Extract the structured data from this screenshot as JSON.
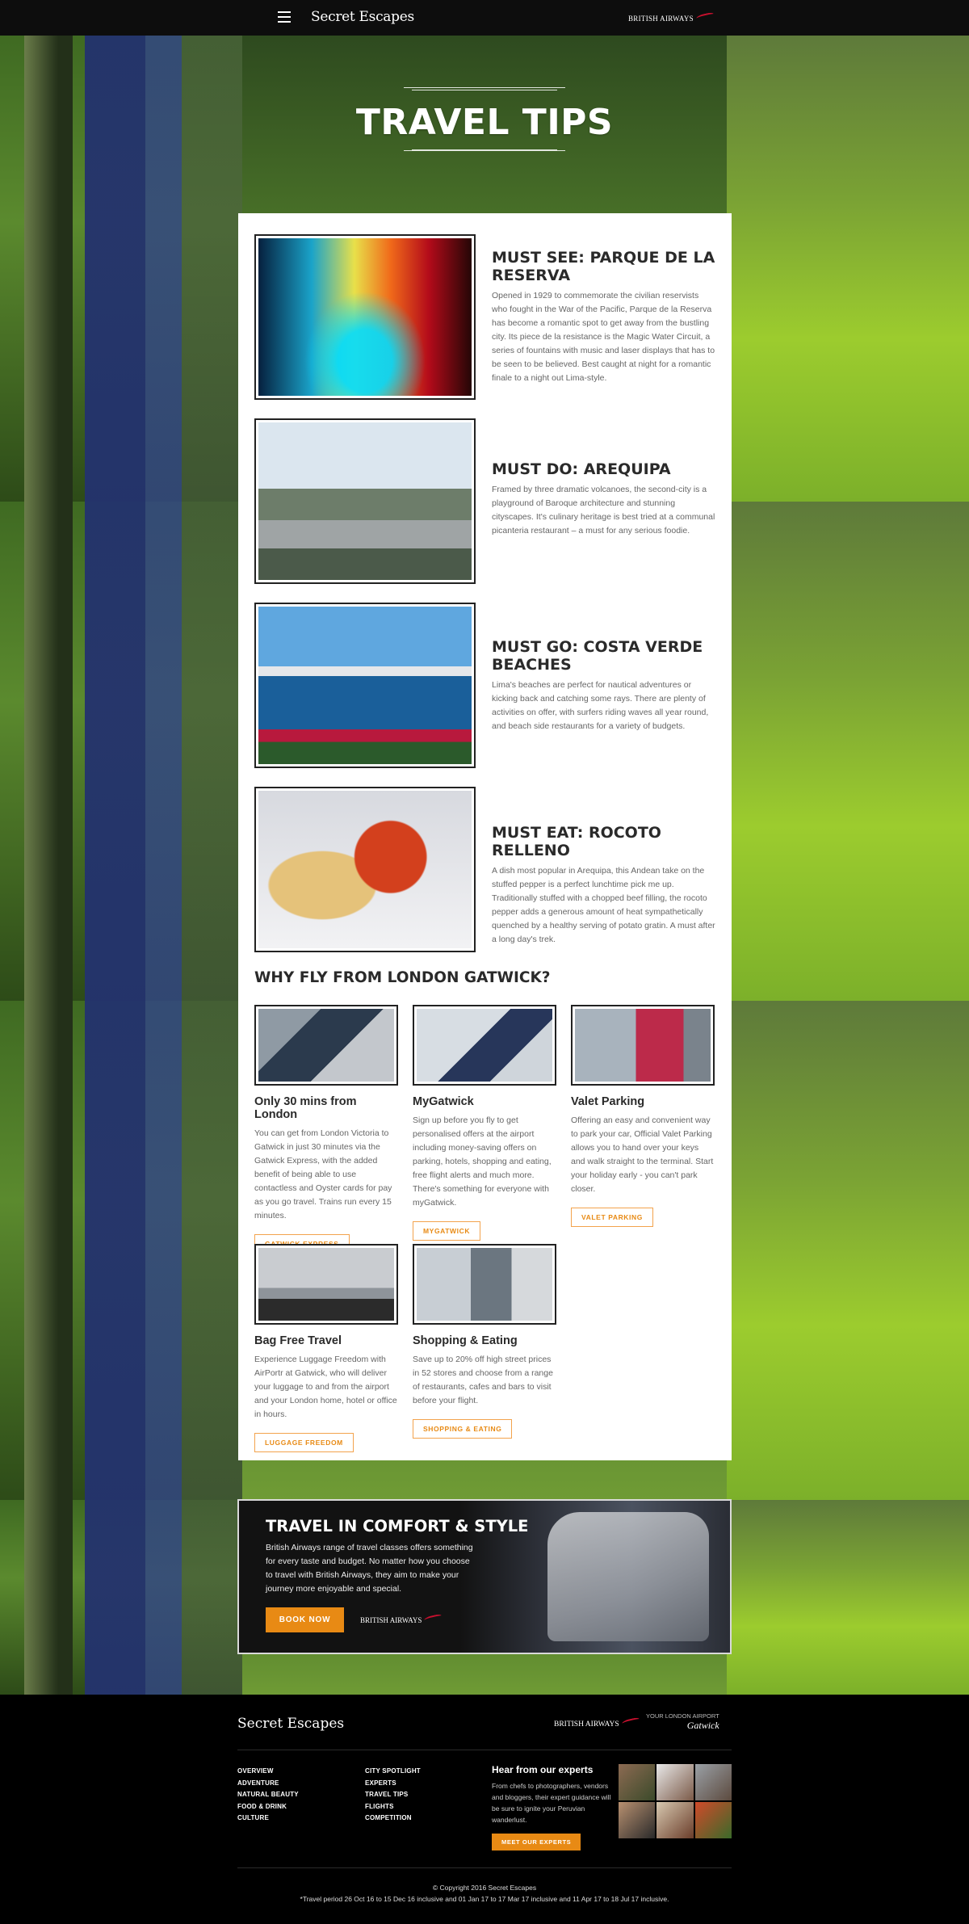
{
  "header": {
    "brand": "Secret Escapes",
    "partner": "BRITISH AIRWAYS"
  },
  "hero": {
    "title": "TRAVEL TIPS"
  },
  "tips": [
    {
      "title": "MUST SEE: PARQUE DE LA RESERVA",
      "text": "Opened in 1929 to commemorate the civilian reservists who fought in the War of the Pacific, Parque de la Reserva has become a romantic spot to get away from the bustling city. Its piece de la resistance is the Magic Water Circuit, a series of fountains with music and laser displays that has to be seen to be believed. Best caught at night for a romantic finale to a night out Lima-style."
    },
    {
      "title": "MUST DO: AREQUIPA",
      "text": "Framed by three dramatic volcanoes, the second-city is a playground of Baroque architecture and stunning cityscapes. It's culinary heritage is best tried at a communal picanteria restaurant – a must for any serious foodie."
    },
    {
      "title": "MUST GO: COSTA VERDE BEACHES",
      "text": "Lima's beaches are perfect for nautical adventures or kicking back and catching some rays. There are plenty of activities on offer, with surfers riding waves all year round, and beach side restaurants for a variety of budgets."
    },
    {
      "title": "MUST EAT: ROCOTO RELLENO",
      "text": "A dish most popular in Arequipa, this Andean take on the stuffed pepper is a perfect lunchtime pick me up. Traditionally stuffed with a chopped beef filling, the rocoto pepper adds a generous amount of heat sympathetically quenched by a healthy serving of potato gratin. A must after a long day's trek."
    }
  ],
  "gatwick": {
    "heading": "WHY FLY FROM LONDON GATWICK?",
    "features": [
      {
        "title": "Only 30 mins from London",
        "text": "You can get from London Victoria to Gatwick in just 30 minutes via the Gatwick Express, with the added benefit of being able to use contactless and Oyster cards for pay as you go travel. Trains run every 15 minutes.",
        "button": "GATWICK EXPRESS"
      },
      {
        "title": "MyGatwick",
        "text": "Sign up before you fly to get personalised offers at the airport including money-saving offers on parking, hotels, shopping and eating, free flight alerts and much more. There's something for everyone with myGatwick.",
        "button": "MYGATWICK"
      },
      {
        "title": "Valet Parking",
        "text": "Offering an easy and convenient way to park your car, Official Valet Parking allows you to hand over your keys and walk straight to the terminal. Start your holiday early - you can't park closer.",
        "button": "VALET PARKING"
      },
      {
        "title": "Bag Free Travel",
        "text": "Experience Luggage Freedom with AirPortr at Gatwick, who will deliver your luggage to and from the airport and your London home, hotel or office in hours.",
        "button": "LUGGAGE FREEDOM"
      },
      {
        "title": "Shopping & Eating",
        "text": "Save up to 20% off high street prices in 52 stores and choose from a range of restaurants, cafes and bars to visit before your flight.",
        "button": "SHOPPING & EATING"
      }
    ]
  },
  "comfort": {
    "title": "TRAVEL IN COMFORT & STYLE",
    "text": "British Airways range of travel classes offers something for every taste and budget. No matter how you choose to travel with British Airways, they aim to make your journey more enjoyable and special.",
    "button": "BOOK NOW",
    "partner": "BRITISH AIRWAYS"
  },
  "footer": {
    "brand": "Secret Escapes",
    "partner": "BRITISH AIRWAYS",
    "airport_caption": "YOUR LONDON AIRPORT",
    "airport_name": "Gatwick",
    "links_col1": [
      "OVERVIEW",
      "ADVENTURE",
      "NATURAL BEAUTY",
      "FOOD & DRINK",
      "CULTURE"
    ],
    "links_col2": [
      "CITY SPOTLIGHT",
      "EXPERTS",
      "TRAVEL TIPS",
      "FLIGHTS",
      "COMPETITION"
    ],
    "experts_heading": "Hear from our experts",
    "experts_text": "From chefs to photographers, vendors and bloggers, their expert guidance will be sure to ignite your Peruvian wanderlust.",
    "experts_button": "MEET OUR EXPERTS",
    "copyright": "© Copyright 2016 Secret Escapes",
    "terms": "*Travel period 26 Oct 16 to 15 Dec 16 inclusive and 01 Jan 17 to 17 Mar 17 inclusive and 11 Apr 17 to 18 Jul 17 inclusive."
  }
}
